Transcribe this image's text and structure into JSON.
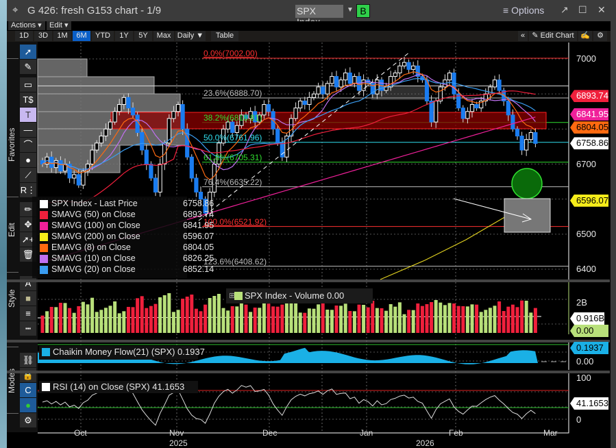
{
  "window": {
    "title": "G 426: fresh G153 chart - 1/9",
    "ticker": "SPX Index",
    "b_button": "B",
    "options": "Options",
    "pop_out": "↗",
    "maximize": "☐",
    "close": "✕",
    "crosshair": "⌖"
  },
  "menus": {
    "actions": "Actions ▾",
    "edit": "Edit ▾"
  },
  "periods": [
    {
      "label": "1D"
    },
    {
      "label": "3D"
    },
    {
      "label": "1M"
    },
    {
      "label": "6M",
      "selected": true
    },
    {
      "label": "YTD"
    },
    {
      "label": "1Y"
    },
    {
      "label": "5Y"
    },
    {
      "label": "Max"
    },
    {
      "label": "Daily ▼"
    },
    {
      "label": "Table"
    }
  ],
  "edit_chart": {
    "collapse": "«",
    "label": "✎ Edit Chart",
    "annotate": "✍",
    "settings": "⚙"
  },
  "toolbar": {
    "favorites": "Favorites",
    "edit": "Edit",
    "style": "Style",
    "modes": "Modes",
    "tools": [
      "cursor-arrow",
      "pen",
      "rectangle",
      "price-marker",
      "text",
      "horizontal-line",
      "arc",
      "circle",
      "line-segment",
      "r-ruler",
      "pencil",
      "move",
      "select-plus",
      "trash",
      "font",
      "fill-color",
      "line-weight",
      "line-style",
      "link",
      "lock",
      "magnet",
      "color-palette",
      "settings"
    ]
  },
  "legend": {
    "items": [
      {
        "name": "SPX Index - Last Price",
        "value": "6758.86",
        "color": "#ffffff"
      },
      {
        "name": "SMAVG (50)  on Close",
        "value": "6893.74",
        "color": "#f0203c"
      },
      {
        "name": "SMAVG (100)  on Close",
        "value": "6841.95",
        "color": "#f0209a"
      },
      {
        "name": "SMAVG (200)  on Close",
        "value": "6596.07",
        "color": "#f5ec1a"
      },
      {
        "name": "EMAVG (8)  on Close",
        "value": "6804.05",
        "color": "#ff6a10"
      },
      {
        "name": "SMAVG (10)  on Close",
        "value": "6826.25",
        "color": "#c070f0"
      },
      {
        "name": "SMAVG (20)  on Close",
        "value": "6852.14",
        "color": "#3a9cf0"
      }
    ]
  },
  "fibonacci": [
    {
      "label": "0.0%(7002.00)",
      "value": 7002.0,
      "color": "#ff3030"
    },
    {
      "label": "23.6%(6888.70)",
      "value": 6888.7,
      "color": "#bbbbbb"
    },
    {
      "label": "38.2%(6818.81)",
      "value": 6818.81,
      "color": "#30e030"
    },
    {
      "label": "50.0%(6761.96)",
      "value": 6761.96,
      "color": "#30e0f0"
    },
    {
      "label": "61.8%(6705.31)",
      "value": 6705.31,
      "color": "#30e030"
    },
    {
      "label": "76.4%(6635.22)",
      "value": 6635.22,
      "color": "#bbbbbb"
    },
    {
      "label": "100.0%(6521.92)",
      "value": 6521.92,
      "color": "#ff3030"
    },
    {
      "label": "123.6%(6408.62)",
      "value": 6408.62,
      "color": "#bbbbbb"
    }
  ],
  "price_axis": {
    "ticks": [
      "7000",
      "6700",
      "6500",
      "6400"
    ],
    "tick_values": [
      7000,
      6700,
      6500,
      6400
    ],
    "tags": [
      {
        "text": "6893.74",
        "value": 6893.74,
        "bg": "#f0203c",
        "fg": "#ffffff"
      },
      {
        "text": "6841.95",
        "value": 6841.95,
        "bg": "#f0209a",
        "fg": "#ffffff"
      },
      {
        "text": "6804.05",
        "value": 6804.05,
        "bg": "#ff6a10",
        "fg": "#000000"
      },
      {
        "text": "6758.86",
        "value": 6758.86,
        "bg": "#ffffff",
        "fg": "#000000"
      },
      {
        "text": "6596.07",
        "value": 6596.07,
        "bg": "#f5ec1a",
        "fg": "#000000"
      }
    ]
  },
  "chart_data": {
    "type": "candlestick",
    "closes": [
      6700,
      6720,
      6690,
      6710,
      6680,
      6700,
      6660,
      6670,
      6640,
      6680,
      6700,
      6740,
      6760,
      6780,
      6800,
      6820,
      6850,
      6870,
      6890,
      6860,
      6840,
      6790,
      6740,
      6700,
      6660,
      6620,
      6700,
      6760,
      6830,
      6850,
      6870,
      6800,
      6720,
      6660,
      6620,
      6600,
      6560,
      6620,
      6700,
      6760,
      6800,
      6820,
      6790,
      6810,
      6840,
      6830,
      6850,
      6820,
      6840,
      6870,
      6850,
      6800,
      6760,
      6720,
      6780,
      6830,
      6860,
      6880,
      6870,
      6890,
      6900,
      6920,
      6900,
      6930,
      6950,
      6920,
      6940,
      6960,
      6930,
      6950,
      6910,
      6940,
      6930,
      6900,
      6940,
      6910,
      6920,
      6950,
      6960,
      6980,
      6990,
      6970,
      6980,
      6950,
      6940,
      6880,
      6820,
      6880,
      6920,
      6940,
      6960,
      6900,
      6860,
      6830,
      6850,
      6870,
      6860,
      6880,
      6900,
      6920,
      6940,
      6910,
      6880,
      6840,
      6800,
      6780,
      6740,
      6770,
      6790,
      6758.86
    ],
    "ylim": [
      6380,
      7050
    ],
    "x_labels": [
      "Oct",
      "Nov",
      "Dec",
      "Jan",
      "Feb",
      "Mar"
    ],
    "year_labels": [
      "2025",
      "2026"
    ]
  },
  "volume_panel": {
    "legend": "SPX Index - Volume 0.00",
    "ticks": [
      "2B"
    ],
    "tags": [
      {
        "text": "0.916B",
        "bg": "#ffffff",
        "fg": "#000"
      },
      {
        "text": "0.00",
        "bg": "#b8e07a",
        "fg": "#000"
      }
    ]
  },
  "cmf_panel": {
    "legend": "Chaikin Money Flow(21) (SPX) 0.1937",
    "tag": "0.1937",
    "tick": "0.00"
  },
  "rsi_panel": {
    "legend": "RSI (14)  on Close (SPX) 41.1653",
    "tag": "41.1653",
    "ticks": [
      "100",
      "0"
    ]
  }
}
